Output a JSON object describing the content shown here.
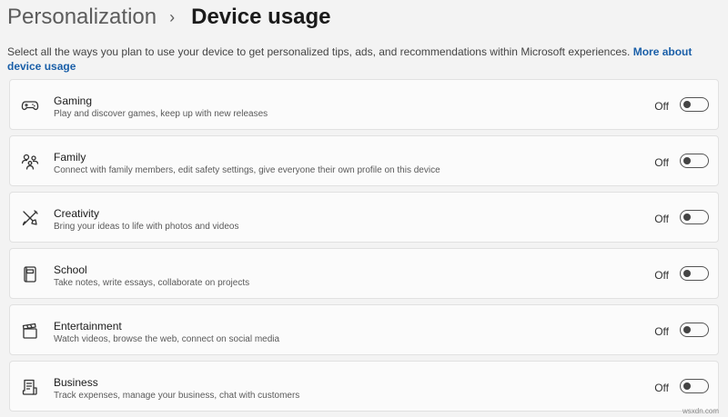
{
  "header": {
    "breadcrumb_parent": "Personalization",
    "separator": "›",
    "title": "Device usage"
  },
  "intro": {
    "text": "Select all the ways you plan to use your device to get personalized tips, ads, and recommendations within Microsoft experiences. ",
    "link": "More about device usage"
  },
  "items": [
    {
      "icon": "gamepad-icon",
      "title": "Gaming",
      "description": "Play and discover games, keep up with new releases",
      "state": "Off"
    },
    {
      "icon": "family-icon",
      "title": "Family",
      "description": "Connect with family members, edit safety settings, give everyone their own profile on this device",
      "state": "Off"
    },
    {
      "icon": "creativity-icon",
      "title": "Creativity",
      "description": "Bring your ideas to life with photos and videos",
      "state": "Off"
    },
    {
      "icon": "school-icon",
      "title": "School",
      "description": "Take notes, write essays, collaborate on projects",
      "state": "Off"
    },
    {
      "icon": "clapperboard-icon",
      "title": "Entertainment",
      "description": "Watch videos, browse the web, connect on social media",
      "state": "Off"
    },
    {
      "icon": "business-icon",
      "title": "Business",
      "description": "Track expenses, manage your business, chat with customers",
      "state": "Off"
    }
  ],
  "watermark": "wsxdn.com"
}
